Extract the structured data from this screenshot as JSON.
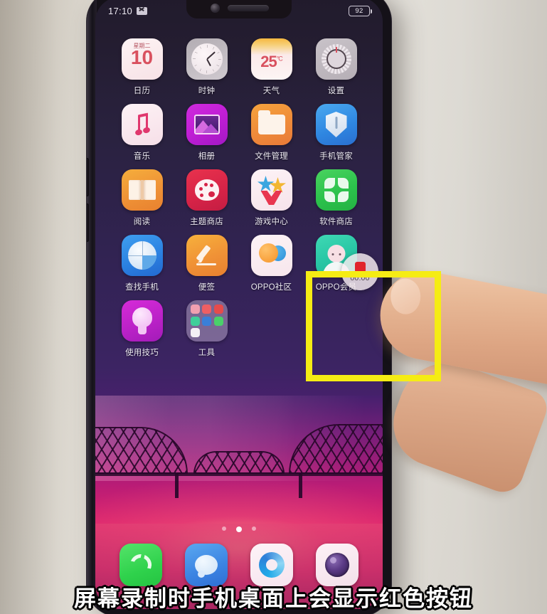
{
  "statusbar": {
    "time": "17:10",
    "mute_icon": "mute-icon",
    "battery_level": "92"
  },
  "homescreen": {
    "rows": [
      [
        {
          "label": "日历",
          "icon": "calendar-icon",
          "weekday": "星期二",
          "day": "10"
        },
        {
          "label": "时钟",
          "icon": "clock-icon"
        },
        {
          "label": "天气",
          "icon": "weather-icon",
          "temperature": "25",
          "unit": "°C"
        },
        {
          "label": "设置",
          "icon": "settings-gear-icon"
        }
      ],
      [
        {
          "label": "音乐",
          "icon": "music-note-icon"
        },
        {
          "label": "相册",
          "icon": "photos-icon"
        },
        {
          "label": "文件管理",
          "icon": "folder-icon"
        },
        {
          "label": "手机管家",
          "icon": "shield-icon"
        }
      ],
      [
        {
          "label": "阅读",
          "icon": "book-icon"
        },
        {
          "label": "主题商店",
          "icon": "palette-icon"
        },
        {
          "label": "游戏中心",
          "icon": "star-icon"
        },
        {
          "label": "软件商店",
          "icon": "app-store-icon"
        }
      ],
      [
        {
          "label": "查找手机",
          "icon": "radar-icon"
        },
        {
          "label": "便签",
          "icon": "pencil-icon"
        },
        {
          "label": "OPPO社区",
          "icon": "bubbles-icon"
        },
        {
          "label": "OPPO会员",
          "icon": "member-person-icon"
        }
      ],
      [
        {
          "label": "使用技巧",
          "icon": "lightbulb-icon"
        },
        {
          "label": "工具",
          "icon": "tools-folder-icon"
        }
      ]
    ],
    "tools_folder_colors": [
      "#f0a0b0",
      "#ef5f63",
      "#e64b4b",
      "#3fcf9a",
      "#3a7fd8",
      "#4ad06a",
      "#f4f0f5"
    ],
    "page_dots": {
      "count": 3,
      "active_index": 1
    },
    "dock": [
      {
        "label": "phone",
        "icon": "phone-handset-icon"
      },
      {
        "label": "messages",
        "icon": "message-bubble-icon"
      },
      {
        "label": "browser",
        "icon": "browser-swirl-icon"
      },
      {
        "label": "camera",
        "icon": "camera-lens-icon"
      }
    ]
  },
  "record_button": {
    "timer": "00:00",
    "stop_icon": "stop-square-icon",
    "stop_color": "#e1242c"
  },
  "annotation": {
    "highlight_color": "#f5ec14",
    "subtitle": "屏幕录制时手机桌面上会显示红色按钮"
  }
}
